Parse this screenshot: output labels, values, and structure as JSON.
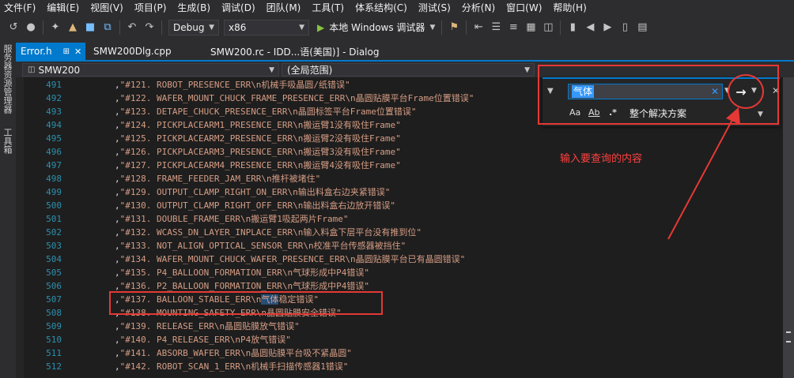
{
  "menu": [
    "文件(F)",
    "编辑(E)",
    "视图(V)",
    "项目(P)",
    "生成(B)",
    "调试(D)",
    "团队(M)",
    "工具(T)",
    "体系结构(C)",
    "测试(S)",
    "分析(N)",
    "窗口(W)",
    "帮助(H)"
  ],
  "toolbar": {
    "config": "Debug",
    "platform": "x86",
    "run_label": "本地 Windows 调试器"
  },
  "sidebar_tabs": [
    "服务器资源管理器",
    "工具箱"
  ],
  "tabs": [
    {
      "label": "Error.h",
      "active": true
    },
    {
      "label": "SMW200Dlg.cpp",
      "active": false
    },
    {
      "label": "SMW200.rc - IDD...语(美国)] - Dialog",
      "active": false
    }
  ],
  "navbar": {
    "project": "SMW200",
    "scope": "(全局范围)"
  },
  "find": {
    "query": "气体",
    "scope": "整个解决方案",
    "opt_case": "Aa",
    "opt_word": "Ab",
    "opt_regex": ".*"
  },
  "annotation": "输入要查询的内容",
  "colors": {
    "accent": "#007acc",
    "string": "#d69d85",
    "linenum": "#2b91af",
    "annotation": "#e53935"
  },
  "lines": [
    {
      "n": "491",
      "t": "\"#121. ROBOT_PRESENCE_ERR\\n机械手吸晶圆/纸错误\""
    },
    {
      "n": "492",
      "t": "\"#122. WAFER_MOUNT_CHUCK_FRAME_PRESENCE_ERR\\n晶圆贴膜平台Frame位置错误\""
    },
    {
      "n": "493",
      "t": "\"#123. DETAPE_CHUCK_PRESENCE_ERR\\n晶圆标签平台Frame位置错误\""
    },
    {
      "n": "494",
      "t": "\"#124. PICKPLACEARM1_PRESENCE_ERR\\n搬运臂1没有吸住Frame\""
    },
    {
      "n": "495",
      "t": "\"#125. PICKPLACEARM2_PRESENCE_ERR\\n搬运臂2没有吸住Frame\""
    },
    {
      "n": "496",
      "t": "\"#126. PICKPLACEARM3_PRESENCE_ERR\\n搬运臂3没有吸住Frame\""
    },
    {
      "n": "497",
      "t": "\"#127. PICKPLACEARM4_PRESENCE_ERR\\n搬运臂4没有吸住Frame\""
    },
    {
      "n": "498",
      "t": "\"#128. FRAME_FEEDER_JAM_ERR\\n推杆被堵住\""
    },
    {
      "n": "499",
      "t": "\"#129. OUTPUT_CLAMP_RIGHT_ON_ERR\\n输出料盒右边夹紧错误\""
    },
    {
      "n": "500",
      "t": "\"#130. OUTPUT_CLAMP_RIGHT_OFF_ERR\\n输出料盒右边放开错误\""
    },
    {
      "n": "501",
      "t": "\"#131. DOUBLE_FRAME_ERR\\n搬运臂1吸起两片Frame\""
    },
    {
      "n": "502",
      "t": "\"#132. WCASS_DN_LAYER_INPLACE_ERR\\n输入料盒下层平台没有推到位\""
    },
    {
      "n": "503",
      "t": "\"#133. NOT_ALIGN_OPTICAL_SENSOR_ERR\\n校准平台传感器被挡住\""
    },
    {
      "n": "504",
      "t": "\"#134. WAFER_MOUNT_CHUCK_WAFER_PRESENCE_ERR\\n晶圆贴膜平台已有晶圆错误\""
    },
    {
      "n": "505",
      "t": "\"#135. P4_BALLOON_FORMATION_ERR\\n气球形成中P4错误\""
    },
    {
      "n": "506",
      "t": "\"#136. P2_BALLOON_FORMATION_ERR\\n气球形成中P4错误\""
    },
    {
      "n": "507",
      "t_pre": "\"#137. BALLOON_STABLE_ERR\\n",
      "t_hl": "气体",
      "t_post": "稳定错误\""
    },
    {
      "n": "508",
      "t": "\"#138. MOUNTING_SAFETY_ERR\\n晶圆贴膜安全错误\""
    },
    {
      "n": "509",
      "t": "\"#139. RELEASE_ERR\\n晶圆贴膜放气错误\""
    },
    {
      "n": "510",
      "t": "\"#140. P4_RELEASE_ERR\\nP4放气错误\""
    },
    {
      "n": "511",
      "t": "\"#141. ABSORB_WAFER_ERR\\n晶圆贴膜平台吸不紧晶圆\""
    },
    {
      "n": "512",
      "t": "\"#142. ROBOT_SCAN_1_ERR\\n机械手扫描传感器1错误\""
    }
  ]
}
